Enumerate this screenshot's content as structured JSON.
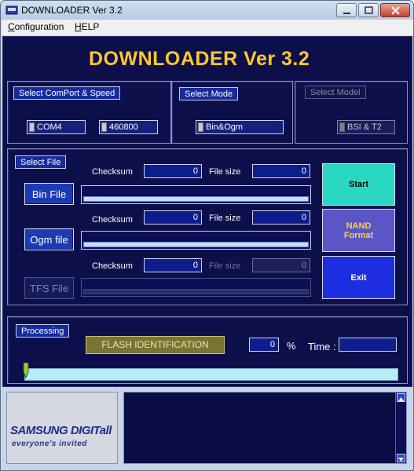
{
  "window": {
    "title": "DOWNLOADER Ver 3.2"
  },
  "menu": {
    "configuration": {
      "underline": "C",
      "rest": "onfiguration"
    },
    "help": {
      "underline": "H",
      "rest": "ELP"
    }
  },
  "app_title": "DOWNLOADER Ver 3.2",
  "comport_group": {
    "label": "Select ComPort & Speed",
    "port": "COM4",
    "speed": "460800"
  },
  "mode_group": {
    "label": "Select Mode",
    "mode": "Bin&Ogm"
  },
  "model_group": {
    "label": "Select Model",
    "model": "BSI & T2"
  },
  "file_group": {
    "label": "Select File",
    "checksum_label": "Checksum",
    "filesize_label": "File size",
    "rows": [
      {
        "button": "Bin File",
        "checksum": "0",
        "filesize": "0"
      },
      {
        "button": "Ogm file",
        "checksum": "0",
        "filesize": "0"
      },
      {
        "button": "TFS File",
        "checksum": "0",
        "filesize": "0"
      }
    ]
  },
  "actions": {
    "start": "Start",
    "nand_line1": "NAND",
    "nand_line2": "Format",
    "exit": "Exit"
  },
  "processing": {
    "label": "Processing",
    "status": "FLASH IDENTIFICATION",
    "percent": "0",
    "percent_sign": "%",
    "time_label": "Time :",
    "time_value": ""
  },
  "logo": {
    "top": "SAMSUNG DIGITall",
    "bottom": "everyone's invited"
  },
  "colors": {
    "title_gold": "#ffc82d",
    "panel": "#0c0f4a",
    "start": "#2ad8c2",
    "nand": "#5a56c8",
    "exit": "#1c2ee0"
  }
}
